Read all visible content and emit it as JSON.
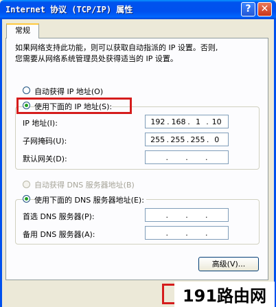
{
  "window": {
    "title": "Internet 协议 (TCP/IP) 属性",
    "help_glyph": "?",
    "close_glyph": "✕"
  },
  "tab": {
    "label": "常规"
  },
  "description": {
    "line1": "如果网络支持此功能，则可以获取自动指派的 IP 设置。否则,",
    "line2": "您需要从网络系统管理员处获得适当的 IP 设置。"
  },
  "ip_section": {
    "auto_label": "自动获得 IP 地址(O)",
    "manual_label": "使用下面的 IP 地址(S):",
    "ip_label": "IP 地址(I):",
    "ip_value": [
      "192",
      "168",
      "1",
      "10"
    ],
    "mask_label": "子网掩码(U):",
    "mask_value": [
      "255",
      "255",
      "255",
      "0"
    ],
    "gateway_label": "默认网关(D):",
    "gateway_value": [
      "",
      "",
      "",
      ""
    ]
  },
  "dns_section": {
    "auto_label": "自动获得 DNS 服务器地址(B)",
    "manual_label": "使用下面的 DNS 服务器地址(E):",
    "preferred_label": "首选 DNS 服务器(P):",
    "alternate_label": "备用 DNS 服务器(A):"
  },
  "buttons": {
    "advanced": "高级(V)..."
  },
  "watermark": {
    "text": "191路由网"
  }
}
